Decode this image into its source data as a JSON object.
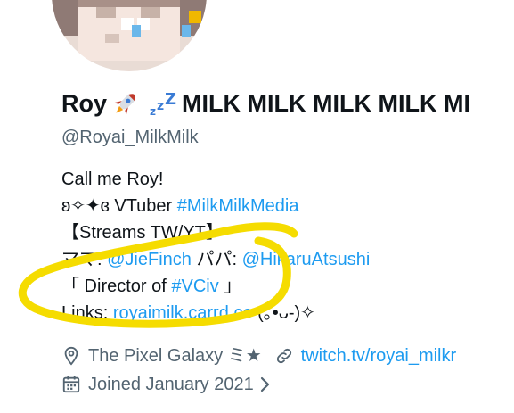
{
  "profile": {
    "display_name": "Roy",
    "display_name_suffix": "MILK MILK MILK MILK MI",
    "emojis": [
      "rocket-emoji",
      "zzz-emoji"
    ],
    "handle": "@Royai_MilkMilk"
  },
  "bio": {
    "line1": "Call me Roy!",
    "line2_prefix": "ʚ✧✦ɞ VTuber ",
    "line2_link": "#MilkMilkMedia",
    "line3": "【Streams TW/YT】",
    "line4_prefix": "ママ: ",
    "line4_link1": "@JieFinch",
    "line4_mid": " パパ: ",
    "line4_link2": "@HikaruAtsushi",
    "line5_prefix": "「 Director of ",
    "line5_link": "#VCiv",
    "line5_suffix": " 」",
    "line6_prefix": "Links: ",
    "line6_link": "royaimilk.carrd.co",
    "line6_suffix": " (｡•ᴗ-)✧"
  },
  "meta": {
    "location": "The Pixel Galaxy ミ★",
    "website": "twitch.tv/royai_milkr",
    "joined": "Joined January 2021"
  },
  "colors": {
    "link": "#1d9bf0",
    "secondary": "#536471",
    "highlight_circle": "#f5dc00"
  }
}
